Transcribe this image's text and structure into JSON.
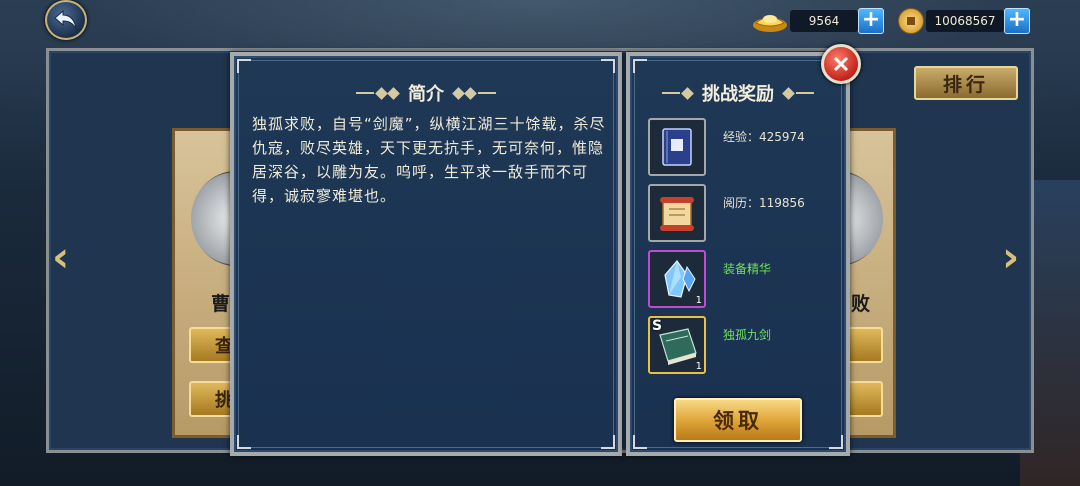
{
  "currency": {
    "ingot_value": "9564",
    "coin_value": "10068567"
  },
  "header": {
    "rank_label": "排行"
  },
  "side_cards": {
    "left_name": "曹",
    "left_btn1": "查",
    "left_btn2": "挑",
    "right_name": "败"
  },
  "intro_panel": {
    "title": "简介",
    "text": "独孤求败，自号“剑魔”，纵横江湖三十馀载，杀尽仇寇，败尽英雄，天下更无抗手，无可奈何，惟隐居深谷，以雕为友。呜呼，生平求一敌手而不可得，诚寂寥难堪也。"
  },
  "reward_panel": {
    "title": "挑战奖励",
    "rewards": [
      {
        "label": "经验：425974",
        "icon": "book-icon",
        "qty": ""
      },
      {
        "label": "阅历：119856",
        "icon": "scroll-icon",
        "qty": ""
      },
      {
        "label": "装备精华",
        "icon": "crystal-icon",
        "qty": "1"
      },
      {
        "label": "独孤九剑",
        "icon": "skill-book-icon",
        "qty": "1",
        "badge": "S"
      }
    ],
    "claim_label": "领取"
  },
  "colors": {
    "panel_bg": "#1e3856",
    "green_text": "#6fe05a",
    "gold_button": "#e0a63a",
    "close_red": "#c2231a"
  }
}
